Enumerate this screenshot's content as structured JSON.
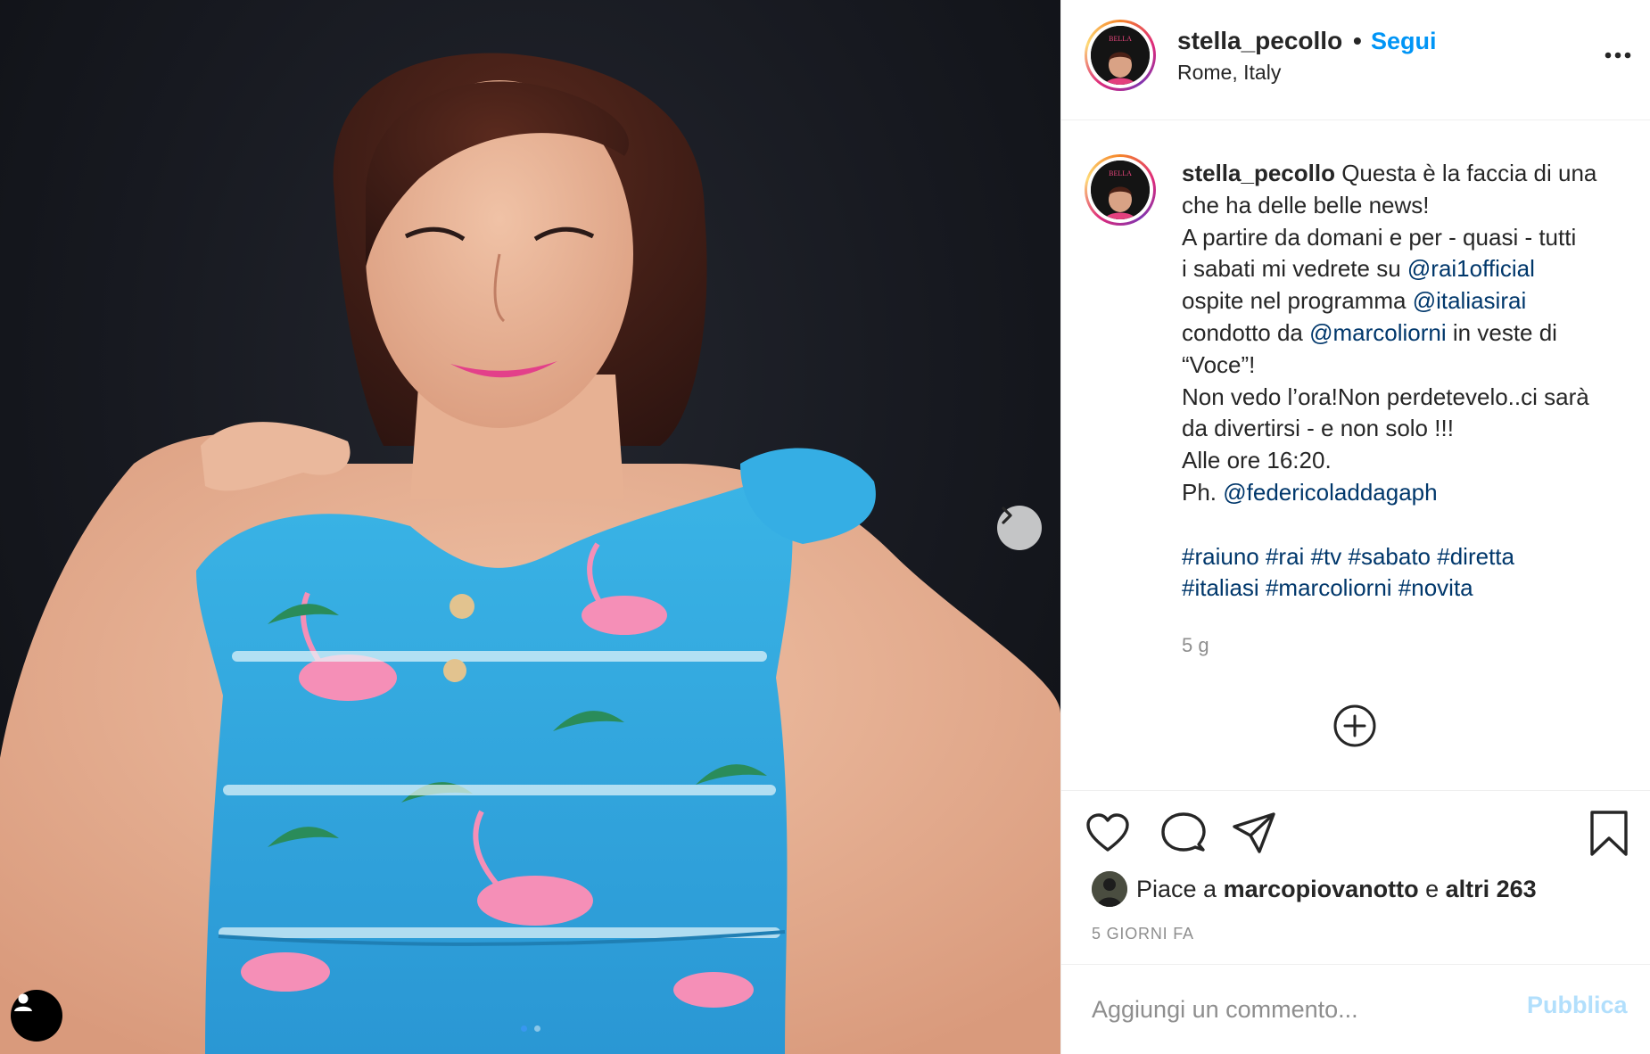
{
  "post": {
    "username": "stella_pecollo",
    "follow_separator": "•",
    "follow_label": "Segui",
    "location": "Rome, Italy",
    "avatar_text": "BELLA",
    "image_alt": "Woman in a blue flamingo-print dress posing against a dark backdrop"
  },
  "caption": {
    "username": "stella_pecollo",
    "line1_text": " Questa è la faccia di una",
    "line2": "che ha delle belle news!",
    "line3": "A partire da domani e per - quasi - tutti",
    "line4_prefix": "i sabati mi vedrete su ",
    "line4_mention": "@rai1official",
    "line5_prefix": "ospite nel programma ",
    "line5_mention": "@italiasirai",
    "line6_prefix": "condotto da ",
    "line6_mention": "@marcoliorni",
    "line6_suffix": " in veste di",
    "line7": "“Voce”!",
    "line8": "Non vedo l’ora!Non perdetevelo..ci sarà",
    "line9": "da divertirsi - e non solo !!!",
    "line10": "Alle ore 16:20.",
    "line11_prefix": "Ph. ",
    "line11_mention": "@federicoladdagaph",
    "hashtags_line1": [
      "#raiuno",
      "#rai",
      "#tv",
      "#sabato",
      "#diretta"
    ],
    "hashtags_line2": [
      "#italiasi",
      "#marcoliorni",
      "#novita"
    ],
    "age": "5 g"
  },
  "likes": {
    "prefix": "Piace a ",
    "user": "marcopiovanotto",
    "middle": " e ",
    "others": "altri 263"
  },
  "time_ago": "5 GIORNI FA",
  "comment": {
    "placeholder": "Aggiungi un commento...",
    "publish_label": "Pubblica"
  },
  "icons": {
    "next": "chevron-right-icon",
    "tag": "user-tag-icon",
    "more": "more-horizontal-icon",
    "load_more": "plus-circle-icon",
    "like": "heart-icon",
    "comment": "comment-icon",
    "share": "paper-plane-icon",
    "save": "bookmark-icon"
  },
  "colors": {
    "link": "#00376b",
    "follow": "#0095f6",
    "publish_disabled": "#b2dffc",
    "muted": "#8e8e8e"
  }
}
